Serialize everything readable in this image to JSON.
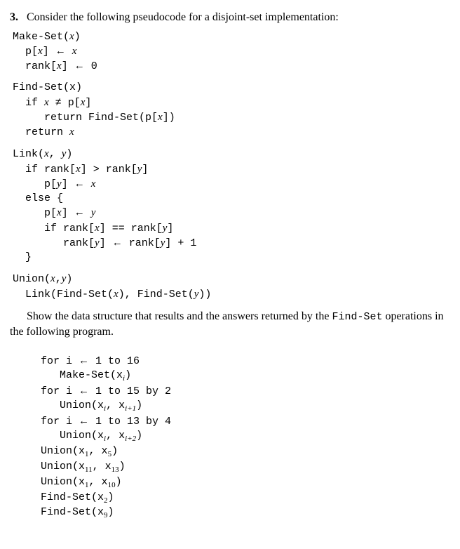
{
  "question": {
    "number": "3.",
    "intro": "Consider the following pseudocode for a disjoint-set implementation:"
  },
  "procs": {
    "makeset_sig_open": "Make-Set(",
    "makeset_sig_close": ")",
    "makeset_l1_a": "p[",
    "makeset_l1_b": "] ",
    "makeset_l1_c": " ",
    "makeset_l2_a": "rank[",
    "makeset_l2_b": "] ",
    "makeset_l2_c": " 0",
    "findset_sig": "Find-Set(x)",
    "findset_l1_a": "if ",
    "findset_l1_b": " ≠ p[",
    "findset_l1_c": "]",
    "findset_l2_a": "return Find-Set(p[",
    "findset_l2_b": "])",
    "findset_l3_a": "return ",
    "link_sig_a": "Link(",
    "link_sig_b": ", ",
    "link_sig_c": ")",
    "link_l1_a": "if rank[",
    "link_l1_b": "] > rank[",
    "link_l1_c": "]",
    "link_l2_a": "p[",
    "link_l2_b": "] ",
    "link_l2_c": " ",
    "link_l3": "else {",
    "link_l4_a": "p[",
    "link_l4_b": "] ",
    "link_l4_c": " ",
    "link_l5_a": "if rank[",
    "link_l5_b": "] == rank[",
    "link_l5_c": "]",
    "link_l6_a": "rank[",
    "link_l6_b": "] ",
    "link_l6_c": " rank[",
    "link_l6_d": "] + 1",
    "link_l7": "}",
    "union_sig_a": "Union(",
    "union_sig_b": ",",
    "union_sig_c": ")",
    "union_l1_a": "Link(Find-Set(",
    "union_l1_b": "), Find-Set(",
    "union_l1_c": "))"
  },
  "vars": {
    "x": "x",
    "y": "y"
  },
  "arrow": "←",
  "task": {
    "pre": "Show the data structure that results and the answers returned by the ",
    "fn": "Find-Set",
    "post": " operations in the following program."
  },
  "program": {
    "l1_a": "for i ",
    "l1_b": " 1 to 16",
    "l2_a": "Make-Set(",
    "l2_b": ")",
    "l3_a": "for i ",
    "l3_b": " 1 to 15 by 2",
    "l4_a": "Union(",
    "l4_b": ", ",
    "l4_c": ")",
    "l5_a": "for i ",
    "l5_b": " 1 to 13 by 4",
    "l6_a": "Union(",
    "l6_b": ", ",
    "l6_c": ")",
    "l7_a": "Union(",
    "l7_b": ", ",
    "l7_c": ")",
    "l8_a": "Union(",
    "l8_b": ", ",
    "l8_c": ")",
    "l9_a": "Union(",
    "l9_b": ", ",
    "l9_c": ")",
    "l10_a": "Find-Set(",
    "l10_b": ")",
    "l11_a": "Find-Set(",
    "l11_b": ")"
  },
  "subs": {
    "i": "i",
    "ip1": "i+1",
    "ip2": "i+2",
    "s1": "1",
    "s2": "2",
    "s5": "5",
    "s9": "9",
    "s10": "10",
    "s11": "11",
    "s13": "13"
  }
}
